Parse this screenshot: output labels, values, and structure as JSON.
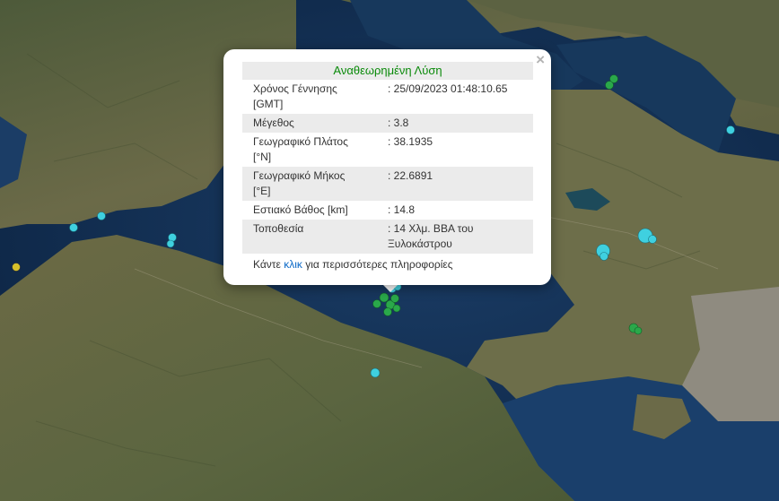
{
  "popup": {
    "title": "Αναθεωρημένη Λύση",
    "close": "×",
    "rows": [
      {
        "label": "Χρόνος Γέννησης [GMT]",
        "value": ": 25/09/2023 01:48:10.65"
      },
      {
        "label": "Μέγεθος",
        "value": ": 3.8"
      },
      {
        "label": "Γεωγραφικό Πλάτος [°N]",
        "value": ": 38.1935"
      },
      {
        "label": "Γεωγραφικό Μήκος [°E]",
        "value": ": 22.6891"
      },
      {
        "label": "Εστιακό Βάθος [km]",
        "value": ": 14.8"
      },
      {
        "label": "Τοποθεσία",
        "value": ": 14 Χλμ. ΒΒΑ του Ξυλοκάστρου"
      }
    ],
    "more_before": "Κάντε ",
    "more_link": "κλικ",
    "more_after": " για περισσότερες πληροφορίες"
  },
  "colors": {
    "marker_green": "#2aa84a",
    "marker_cyan": "#3fd0e0",
    "marker_yellow": "#d6c02a",
    "title_green": "#0a8a0a",
    "link_blue": "#0b69c7"
  }
}
